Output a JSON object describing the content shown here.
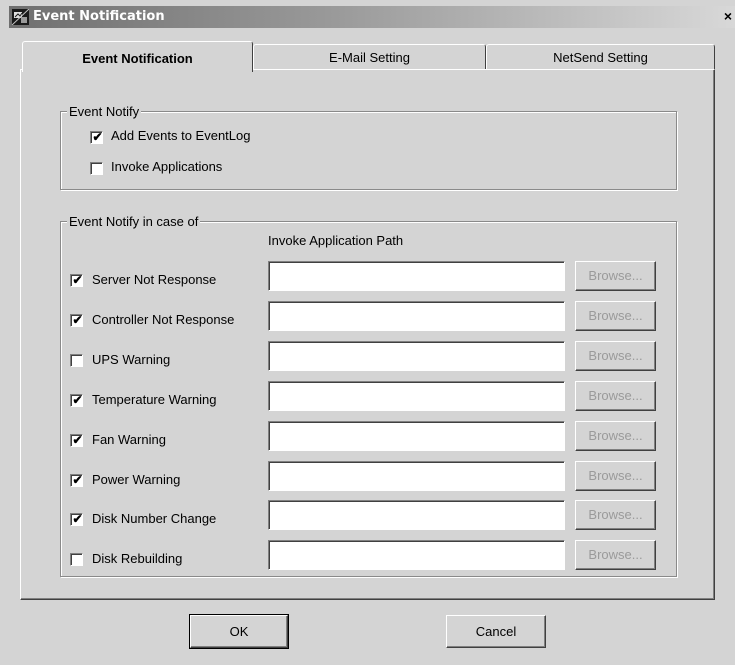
{
  "window": {
    "title": "Event Notification",
    "close_glyph": "×"
  },
  "tabs": [
    {
      "label": "Event Notification",
      "active": true
    },
    {
      "label": "E-Mail Setting",
      "active": false
    },
    {
      "label": "NetSend Setting",
      "active": false
    }
  ],
  "event_notify": {
    "legend": "Event Notify",
    "options": [
      {
        "label": "Add Events to EventLog",
        "checked": true
      },
      {
        "label": "Invoke Applications",
        "checked": false
      }
    ]
  },
  "notify_in_case": {
    "legend": "Event Notify in case of",
    "path_header": "Invoke Application Path",
    "browse_label": "Browse...",
    "rows": [
      {
        "label": "Server Not Response",
        "checked": true,
        "path": ""
      },
      {
        "label": "Controller Not Response",
        "checked": true,
        "path": ""
      },
      {
        "label": "UPS Warning",
        "checked": false,
        "path": ""
      },
      {
        "label": "Temperature Warning",
        "checked": true,
        "path": ""
      },
      {
        "label": "Fan Warning",
        "checked": true,
        "path": ""
      },
      {
        "label": "Power Warning",
        "checked": true,
        "path": ""
      },
      {
        "label": "Disk Number Change",
        "checked": true,
        "path": ""
      },
      {
        "label": "Disk Rebuilding",
        "checked": false,
        "path": ""
      }
    ]
  },
  "buttons": {
    "ok": "OK",
    "cancel": "Cancel"
  },
  "check_glyph": "✔"
}
